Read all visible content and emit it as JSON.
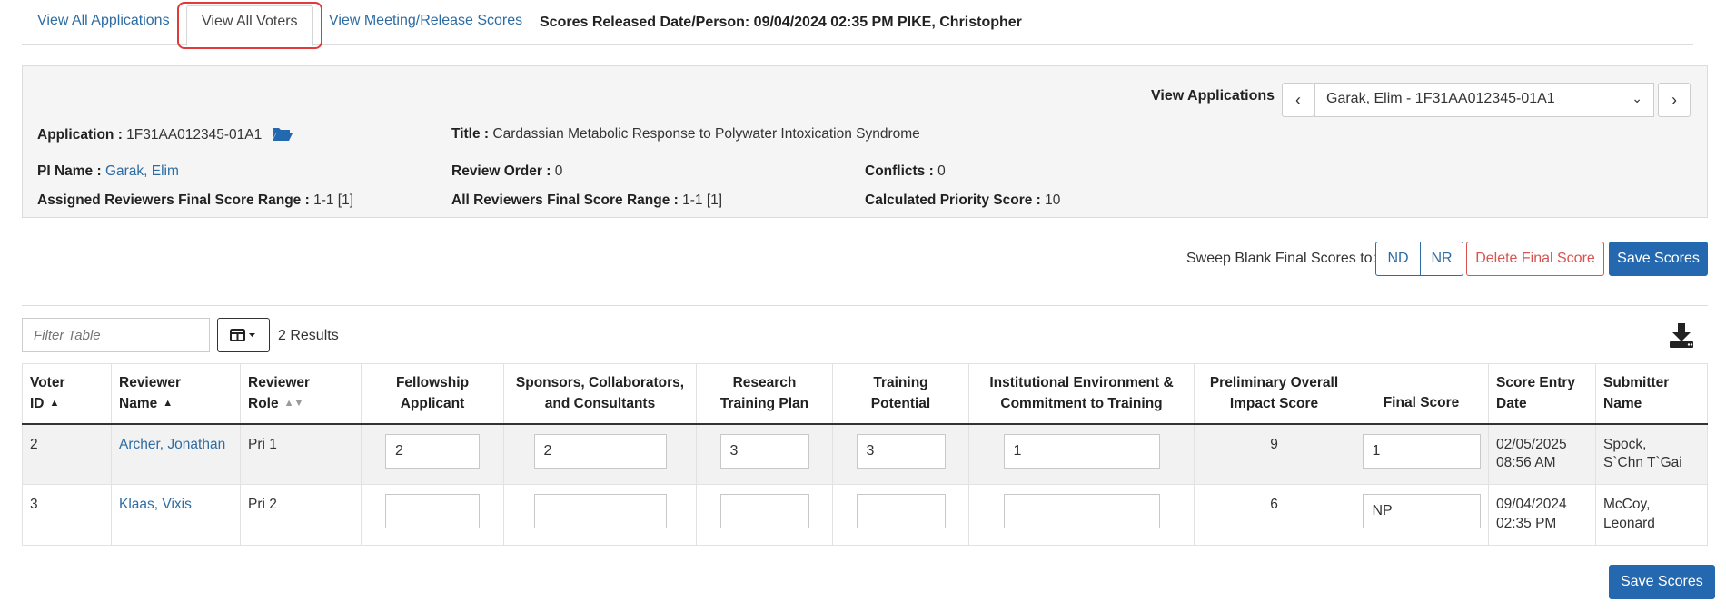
{
  "tabs": {
    "view_all_applications": "View All Applications",
    "view_all_voters": "View All Voters",
    "view_meeting_release_scores": "View Meeting/Release Scores"
  },
  "released": "Scores Released Date/Person: 09/04/2024 02:35 PM PIKE, Christopher",
  "panel": {
    "view_applications_label": "View Applications",
    "selected_application": "Garak, Elim  - 1F31AA012345-01A1",
    "application_label": "Application :",
    "application_value": "1F31AA012345-01A1",
    "title_label": "Title :",
    "title_value": "Cardassian Metabolic Response to Polywater Intoxication Syndrome",
    "pi_label": "PI Name :",
    "pi_value": "Garak, Elim",
    "review_order_label": "Review Order :",
    "review_order_value": "0",
    "conflicts_label": "Conflicts :",
    "conflicts_value": "0",
    "assigned_range_label": "Assigned Reviewers Final Score Range :",
    "assigned_range_value": "1-1 [1]",
    "all_range_label": "All Reviewers Final Score Range :",
    "all_range_value": "1-1 [1]",
    "priority_label": "Calculated Priority Score :",
    "priority_value": "10"
  },
  "actions": {
    "sweep_label": "Sweep Blank Final Scores to:",
    "nd": "ND",
    "nr": "NR",
    "delete_final": "Delete Final Score",
    "save_scores": "Save Scores"
  },
  "filter": {
    "placeholder": "Filter Table",
    "results": "2 Results"
  },
  "table": {
    "headers": {
      "voter_id": [
        "Voter",
        "ID"
      ],
      "reviewer_name": [
        "Reviewer",
        "Name"
      ],
      "reviewer_role": [
        "Reviewer",
        "Role"
      ],
      "fellowship": [
        "Fellowship",
        "Applicant"
      ],
      "sponsors": [
        "Sponsors, Collaborators,",
        "and Consultants"
      ],
      "research": [
        "Research",
        "Training Plan"
      ],
      "training": [
        "Training",
        "Potential"
      ],
      "institutional": [
        "Institutional Environment &",
        "Commitment to Training"
      ],
      "preliminary": [
        "Preliminary Overall",
        "Impact Score"
      ],
      "final": [
        "Final Score"
      ],
      "entry_date": [
        "Score Entry",
        "Date"
      ],
      "submitter": [
        "Submitter",
        "Name"
      ]
    },
    "rows": [
      {
        "voter_id": "2",
        "reviewer_name": "Archer, Jonathan",
        "reviewer_role": "Pri 1",
        "fellowship": "2",
        "sponsors": "2",
        "research": "3",
        "training": "3",
        "institutional": "1",
        "preliminary": "9",
        "final": "1",
        "entry_date_1": "02/05/2025",
        "entry_date_2": "08:56 AM",
        "submitter_1": "Spock,",
        "submitter_2": "S`Chn T`Gai"
      },
      {
        "voter_id": "3",
        "reviewer_name": "Klaas, Vixis",
        "reviewer_role": "Pri 2",
        "fellowship": "",
        "sponsors": "",
        "research": "",
        "training": "",
        "institutional": "",
        "preliminary": "6",
        "final": "NP",
        "entry_date_1": "09/04/2024",
        "entry_date_2": "02:35 PM",
        "submitter_1": "McCoy, Leonard",
        "submitter_2": ""
      }
    ]
  },
  "bottom": {
    "save_scores": "Save Scores"
  },
  "colors": {
    "link": "#2d6ca2",
    "primary": "#2468b0",
    "danger": "#d9534f",
    "highlight": "#e03a3a"
  }
}
